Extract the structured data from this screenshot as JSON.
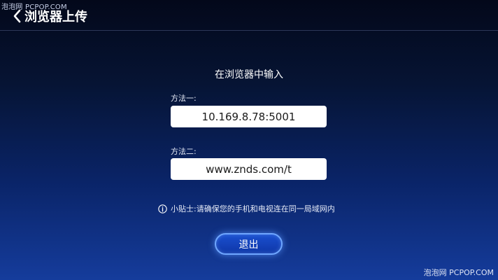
{
  "watermark": {
    "top": "泡泡网 PCPOP.COM",
    "bottom": "泡泡网 PCPOP.COM"
  },
  "header": {
    "back_icon": "chevron-left-icon",
    "title": "浏览器上传"
  },
  "main": {
    "instruction": "在浏览器中输入",
    "methods": [
      {
        "label": "方法一:",
        "address": "10.169.8.78:5001"
      },
      {
        "label": "方法二:",
        "address": "www.znds.com/t"
      }
    ],
    "tip": {
      "icon": "info-icon",
      "text": "小贴士:请确保您的手机和电视连在同一局域网内"
    },
    "exit_label": "退出"
  },
  "colors": {
    "background_top": "#03081a",
    "background_bottom": "#153c9c",
    "button_fill": "#1a4fcf",
    "button_border": "#6fa6ff",
    "box_fill": "#ffffff"
  }
}
